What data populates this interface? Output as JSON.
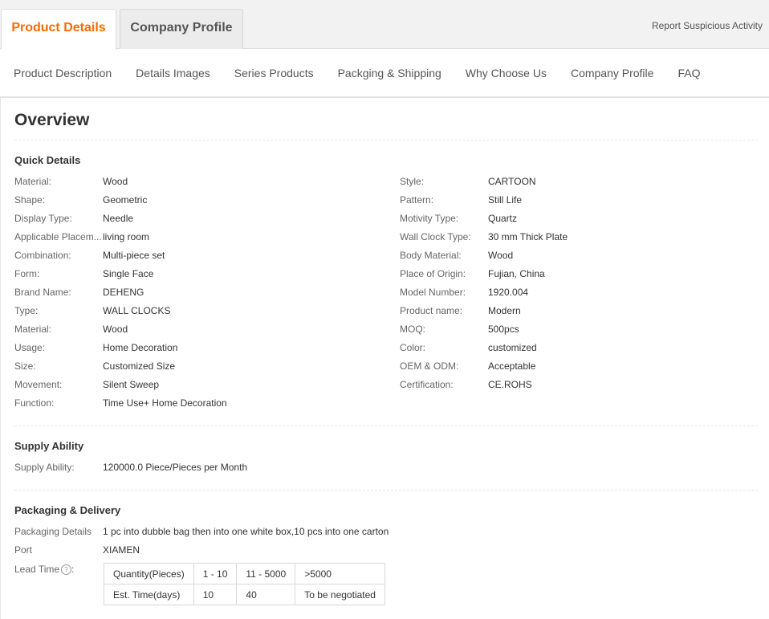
{
  "tabs": {
    "active": "Product Details",
    "inactive": "Company Profile",
    "report": "Report Suspicious Activity"
  },
  "subnav": [
    "Product Description",
    "Details Images",
    "Series Products",
    "Packging & Shipping",
    "Why Choose Us",
    "Company Profile",
    "FAQ"
  ],
  "overview_title": "Overview",
  "quick_details": {
    "title": "Quick Details",
    "left": [
      {
        "label": "Material:",
        "value": "Wood"
      },
      {
        "label": "Shape:",
        "value": "Geometric"
      },
      {
        "label": "Display Type:",
        "value": "Needle"
      },
      {
        "label": "Applicable Placem...",
        "value": "living room"
      },
      {
        "label": "Combination:",
        "value": "Multi-piece set"
      },
      {
        "label": "Form:",
        "value": "Single Face"
      },
      {
        "label": "Brand Name:",
        "value": "DEHENG"
      },
      {
        "label": "Type:",
        "value": "WALL CLOCKS"
      },
      {
        "label": "Material:",
        "value": "Wood"
      },
      {
        "label": "Usage:",
        "value": "Home Decoration"
      },
      {
        "label": "Size:",
        "value": "Customized Size"
      },
      {
        "label": "Movement:",
        "value": "Silent Sweep"
      },
      {
        "label": "Function:",
        "value": "Time Use+ Home Decoration"
      }
    ],
    "right": [
      {
        "label": "Style:",
        "value": "CARTOON"
      },
      {
        "label": "Pattern:",
        "value": "Still Life"
      },
      {
        "label": "Motivity Type:",
        "value": "Quartz"
      },
      {
        "label": "Wall Clock Type:",
        "value": "30 mm Thick Plate"
      },
      {
        "label": "Body Material:",
        "value": "Wood"
      },
      {
        "label": "Place of Origin:",
        "value": "Fujian, China"
      },
      {
        "label": "Model Number:",
        "value": "1920.004"
      },
      {
        "label": "Product name:",
        "value": "Modern"
      },
      {
        "label": "MOQ:",
        "value": "500pcs"
      },
      {
        "label": "Color:",
        "value": "customized"
      },
      {
        "label": "OEM & ODM:",
        "value": "Acceptable"
      },
      {
        "label": "Certification:",
        "value": "CE.ROHS"
      }
    ]
  },
  "supply": {
    "title": "Supply Ability",
    "label": "Supply Ability:",
    "value": "120000.0 Piece/Pieces per Month"
  },
  "packaging": {
    "title": "Packaging & Delivery",
    "details_label": "Packaging Details",
    "details_value": "1 pc into dubble bag then into one white box,10 pcs into one carton",
    "port_label": "Port",
    "port_value": "XIAMEN",
    "lead_label": "Lead Time",
    "lead_icon": "question-icon",
    "lead_table": [
      [
        "Quantity(Pieces)",
        "1 - 10",
        "11 - 5000",
        ">5000"
      ],
      [
        "Est. Time(days)",
        "10",
        "40",
        "To be negotiated"
      ]
    ]
  }
}
